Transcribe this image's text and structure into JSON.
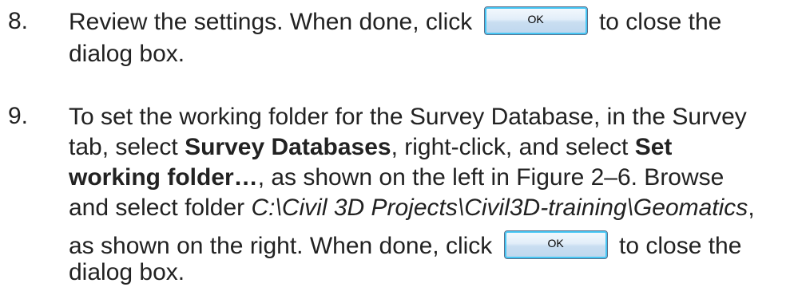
{
  "step8": {
    "number": "8.",
    "line1_before": "Review the settings. When done, click",
    "ok_label": "OK",
    "line1_after": "to close the",
    "line2": "dialog box."
  },
  "step9": {
    "number": "9.",
    "line1": "To set the working folder for the Survey Database, in the Survey",
    "line2_a": "tab, select ",
    "line2_bold": "Survey Databases",
    "line2_b": ", right-click, and select ",
    "line2_bold2": "Set",
    "line3_bold": "working folder…",
    "line3_rest": ", as shown on the left in Figure 2–6. Browse",
    "line4_a": "and select folder ",
    "line4_italic": "C:\\Civil 3D Projects\\Civil3D-training\\Geomatics",
    "line4_b": ",",
    "line5_before": "as shown on the right. When done, click",
    "ok_label": "OK",
    "line5_after": "to close the",
    "line6": "dialog box."
  }
}
